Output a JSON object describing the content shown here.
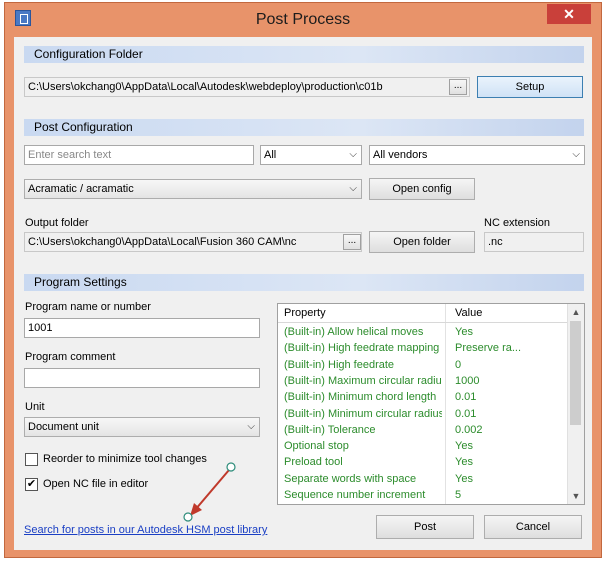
{
  "window": {
    "title": "Post Process",
    "close_glyph": "✕"
  },
  "config_folder": {
    "header": "Configuration Folder",
    "path": "C:\\Users\\okchang0\\AppData\\Local\\Autodesk\\webdeploy\\production\\c01b",
    "browse_label": "...",
    "setup_label": "Setup"
  },
  "post_config": {
    "header": "Post Configuration",
    "search_placeholder": "Enter search text",
    "filter_value": "All",
    "vendor_value": "All vendors",
    "post_value": "Acramatic / acramatic",
    "open_config_label": "Open config",
    "output_folder_label": "Output folder",
    "output_folder_path": "C:\\Users\\okchang0\\AppData\\Local\\Fusion 360 CAM\\nc",
    "browse_label": "...",
    "open_folder_label": "Open folder",
    "nc_extension_label": "NC extension",
    "nc_extension_value": ".nc"
  },
  "program_settings": {
    "header": "Program Settings",
    "program_name_label": "Program name or number",
    "program_name_value": "1001",
    "program_comment_label": "Program comment",
    "program_comment_value": "",
    "unit_label": "Unit",
    "unit_value": "Document unit",
    "reorder_label": "Reorder to minimize tool changes",
    "reorder_checked": false,
    "open_nc_label": "Open NC file in editor",
    "open_nc_checked": true,
    "open_nc_check_glyph": "✔",
    "properties": {
      "col_property": "Property",
      "col_value": "Value",
      "rows": [
        {
          "property": "(Built-in) Allow helical moves",
          "value": "Yes"
        },
        {
          "property": "(Built-in) High feedrate mapping",
          "value": "Preserve ra..."
        },
        {
          "property": "(Built-in) High feedrate",
          "value": "0"
        },
        {
          "property": "(Built-in) Maximum circular radius",
          "value": "1000"
        },
        {
          "property": "(Built-in) Minimum chord length",
          "value": "0.01"
        },
        {
          "property": "(Built-in) Minimum circular radius",
          "value": "0.01"
        },
        {
          "property": "(Built-in) Tolerance",
          "value": "0.002"
        },
        {
          "property": "Optional stop",
          "value": "Yes"
        },
        {
          "property": "Preload tool",
          "value": "Yes"
        },
        {
          "property": "Separate words with space",
          "value": "Yes"
        },
        {
          "property": "Sequence number increment",
          "value": "5"
        }
      ]
    }
  },
  "footer": {
    "library_link": "Search for posts in our Autodesk HSM post library",
    "post_label": "Post",
    "cancel_label": "Cancel"
  },
  "colors": {
    "title_bar": "#e8936a",
    "section_bar": "#c9d9f1",
    "property_text": "#2c8c2c",
    "link": "#1a3fc4",
    "annotation_arrow": "#c0392b"
  }
}
